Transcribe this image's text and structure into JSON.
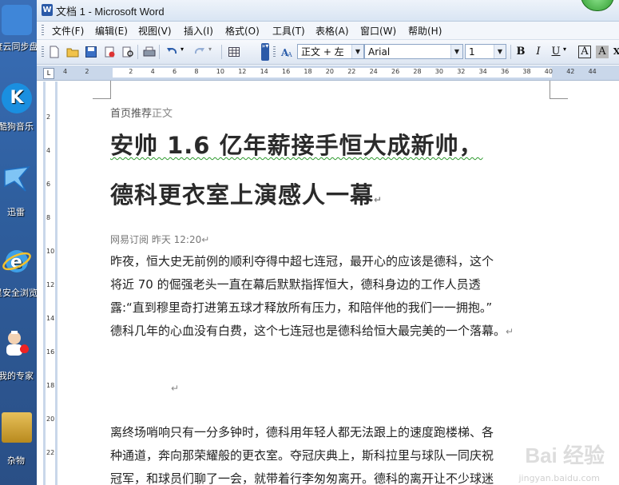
{
  "desktop": {
    "icons": [
      {
        "label": "度云同步盘",
        "color": "#3f86d8"
      },
      {
        "label": "酷狗音乐",
        "color": "#1a8fe0"
      },
      {
        "label": "迅雷",
        "color": "#2f7fd8"
      },
      {
        "label": "星安全浏览器",
        "color": "#2a9adf"
      },
      {
        "label": "我的专家",
        "color": "#f0f0f0"
      },
      {
        "label": "杂物",
        "color": "#d9a93b"
      }
    ]
  },
  "window": {
    "title": "文档 1 - Microsoft Word",
    "icon_glyph": "W"
  },
  "menu": [
    "文件(F)",
    "编辑(E)",
    "视图(V)",
    "插入(I)",
    "格式(O)",
    "工具(T)",
    "表格(A)",
    "窗口(W)",
    "帮助(H)"
  ],
  "toolbar": {
    "style_value": "正文 + 左",
    "font_value": "Arial",
    "size_value": "1",
    "bold": "B",
    "italic": "I",
    "underline": "U",
    "char_border": "A",
    "char_shade": "A",
    "grow_font": "X"
  },
  "ruler": {
    "numbers": [
      "4",
      "2",
      "",
      "2",
      "4",
      "6",
      "8",
      "10",
      "12",
      "14",
      "16",
      "18",
      "20",
      "22",
      "24",
      "26",
      "28",
      "30",
      "32",
      "34",
      "36",
      "38",
      "40",
      "42",
      "44"
    ]
  },
  "vruler": {
    "numbers": [
      "2",
      "4",
      "6",
      "8",
      "10",
      "12",
      "14",
      "16",
      "18",
      "20",
      "22"
    ]
  },
  "document": {
    "breadcrumb_home": "首页推荐",
    "breadcrumb_current": "正文",
    "headline_line1": "安帅 1.6 亿年薪接手恒大成新帅，",
    "headline_line2": "德科更衣室上演感人一幕",
    "meta": "网易订阅 昨天 12:20",
    "para1": [
      "昨夜，恒大史无前例的顺利夺得中超七连冠，最开心的应该是德科，这个",
      "将近 70 的倔强老头一直在幕后默默指挥恒大，德科身边的工作人员透",
      "露:“直到穆里奇打进第五球才释放所有压力，和陪伴他的我们一一拥抱。”",
      "德科几年的心血没有白费，这个七连冠也是德科给恒大最完美的一个落幕。"
    ],
    "para2": [
      "离终场哨响只有一分多钟时，德科用年轻人都无法跟上的速度跑楼梯、各",
      "种通道，奔向那荣耀般的更衣室。夺冠庆典上，斯科拉里与球队一同庆祝",
      "冠军，和球员们聊了一会，就带着行李匆匆离开。德科的离开让不少球迷"
    ],
    "para_mark": "↵"
  },
  "watermark": {
    "text": "Bai 经验",
    "sub": "jingyan.baidu.com"
  }
}
